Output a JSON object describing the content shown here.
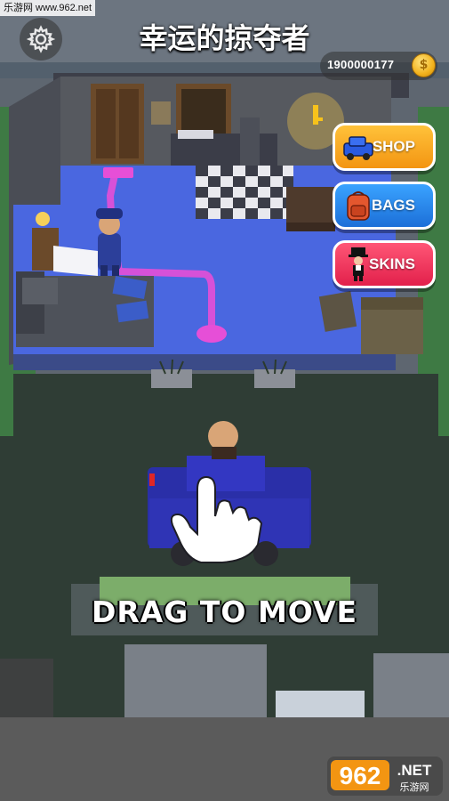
{
  "watermark_top": "乐游网 www.962.net",
  "title": "幸运的掠夺者",
  "coins": "1900000177",
  "coin_symbol": "$",
  "buttons": {
    "shop": "SHOP",
    "bags": "BAGS",
    "skins": "SKINS"
  },
  "hint": "DRAG TO MOVE",
  "logo": {
    "number": "962",
    "suffix": ".NET",
    "subtitle": "乐游网"
  },
  "colors": {
    "shop": "#f39512",
    "bags": "#1c6fd8",
    "skins": "#e2204b",
    "floor": "#4a67e0",
    "path": "#e64fd7"
  }
}
